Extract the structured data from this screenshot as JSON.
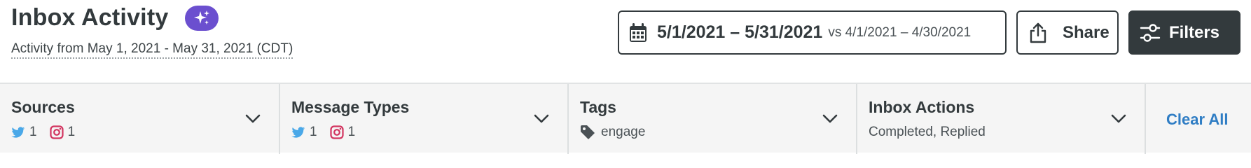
{
  "header": {
    "title": "Inbox Activity",
    "subtitle": "Activity from May 1, 2021 - May 31, 2021 (CDT)"
  },
  "date_range": {
    "primary": "5/1/2021 – 5/31/2021",
    "comparison": "vs 4/1/2021 – 4/30/2021"
  },
  "buttons": {
    "share": "Share",
    "filters": "Filters"
  },
  "filters": {
    "sources": {
      "title": "Sources",
      "twitter_count": "1",
      "instagram_count": "1"
    },
    "message_types": {
      "title": "Message Types",
      "twitter_count": "1",
      "instagram_count": "1"
    },
    "tags": {
      "title": "Tags",
      "value": "engage"
    },
    "inbox_actions": {
      "title": "Inbox Actions",
      "value": "Completed, Replied"
    },
    "clear_all": "Clear All"
  },
  "colors": {
    "text": "#333a3d",
    "badge": "#6b4fcf",
    "twitter": "#4aa8e8",
    "instagram": "#d2345f",
    "link": "#2f7dc4"
  },
  "icons": [
    "sparkle-icon",
    "calendar-icon",
    "share-icon",
    "sliders-icon",
    "chevron-down-icon",
    "twitter-icon",
    "instagram-icon",
    "tag-icon"
  ]
}
